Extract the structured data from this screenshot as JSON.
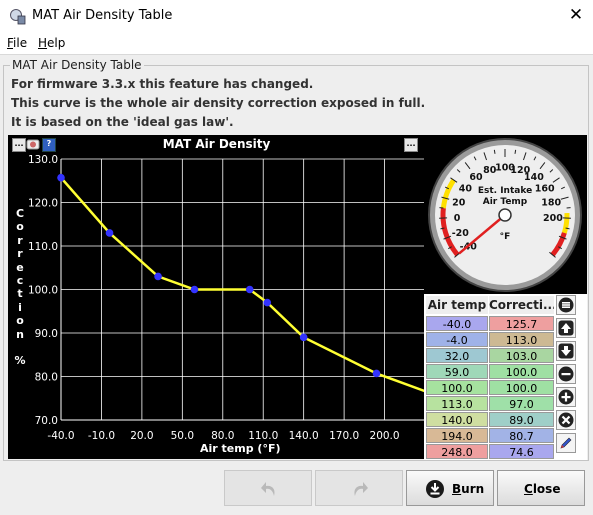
{
  "window": {
    "title": "MAT Air Density Table",
    "close_glyph": "✕"
  },
  "menu": [
    {
      "label": "File",
      "mnemonic": "F",
      "rest": "ile"
    },
    {
      "label": "Help",
      "mnemonic": "H",
      "rest": "elp"
    }
  ],
  "panel": {
    "title": "MAT Air Density Table",
    "info_lines": [
      "For firmware 3.3.x this feature has changed.",
      "This curve is the whole air density correction exposed in full.",
      "It is based on the 'ideal gas law'."
    ]
  },
  "chart_toolbar": {
    "menu_btn": "...",
    "help_btn": "?"
  },
  "chart_data": {
    "type": "line",
    "title": "MAT Air Density",
    "xlabel": "Air temp (°F)",
    "ylabel": "Correction %",
    "x_ticks": [
      "-40.0",
      "-10.0",
      "20.0",
      "50.0",
      "80.0",
      "110.0",
      "140.0",
      "170.0",
      "200.0"
    ],
    "y_ticks": [
      "70.0",
      "80.0",
      "90.0",
      "100.0",
      "110.0",
      "120.0",
      "130.0"
    ],
    "xlim": [
      -40,
      230
    ],
    "ylim": [
      70,
      130
    ],
    "grid": true,
    "x": [
      -40,
      -4,
      32,
      59,
      100,
      113,
      140,
      194,
      248
    ],
    "y": [
      125.7,
      113.0,
      103.0,
      100.0,
      100.0,
      97.0,
      89.0,
      80.7,
      74.6
    ],
    "line_color": "#ffff33",
    "point_color": "#3333ff"
  },
  "gauge": {
    "title_line1": "Est. Intake",
    "title_line2": "Air Temp",
    "unit": "°F",
    "labels": [
      "-40",
      "-20",
      "0",
      "20",
      "40",
      "60",
      "80",
      "100",
      "120",
      "140",
      "160",
      "180",
      "200"
    ],
    "value": -40
  },
  "table": {
    "headers": [
      "Air temp",
      "Correcti..."
    ],
    "rows": [
      {
        "temp": "-40.0",
        "corr": "125.7",
        "temp_color": "#a9a7ee",
        "corr_color": "#ee9f9f"
      },
      {
        "temp": "-4.0",
        "corr": "113.0",
        "temp_color": "#9fb2e8",
        "corr_color": "#cdb993"
      },
      {
        "temp": "32.0",
        "corr": "103.0",
        "temp_color": "#9ec8d2",
        "corr_color": "#a9d6a1"
      },
      {
        "temp": "59.0",
        "corr": "100.0",
        "temp_color": "#9fd8b8",
        "corr_color": "#9fe0a3"
      },
      {
        "temp": "100.0",
        "corr": "100.0",
        "temp_color": "#a6e29f",
        "corr_color": "#9fe0a3"
      },
      {
        "temp": "113.0",
        "corr": "97.0",
        "temp_color": "#b7e29f",
        "corr_color": "#9fe0a8"
      },
      {
        "temp": "140.0",
        "corr": "89.0",
        "temp_color": "#cfdea1",
        "corr_color": "#9fcfc8"
      },
      {
        "temp": "194.0",
        "corr": "80.7",
        "temp_color": "#d8b996",
        "corr_color": "#a2b3e6"
      },
      {
        "temp": "248.0",
        "corr": "74.6",
        "temp_color": "#ee9f9f",
        "corr_color": "#a9a7ee"
      }
    ]
  },
  "side_buttons": [
    "menu-icon",
    "arrow-up-icon",
    "arrow-down-icon",
    "minus-icon",
    "plus-icon",
    "x-circle-icon",
    "pencil-icon"
  ],
  "buttons": {
    "undo_icon": "undo-icon",
    "redo_icon": "redo-icon",
    "burn": "Burn",
    "burn_mnemonic": "B",
    "close": "Close",
    "close_mnemonic": "C"
  }
}
